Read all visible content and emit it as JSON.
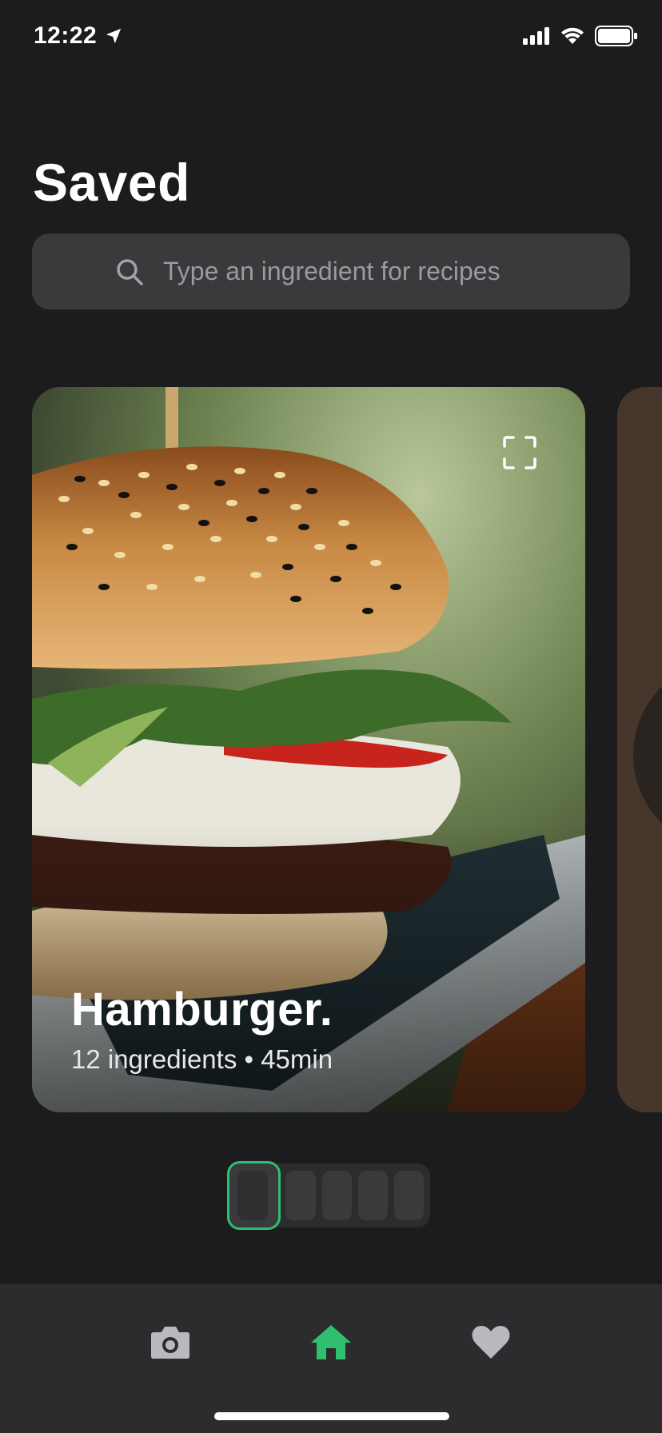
{
  "status_bar": {
    "time": "12:22",
    "icons": [
      "location-arrow-icon",
      "cellular-signal-icon",
      "wifi-icon",
      "battery-icon"
    ]
  },
  "header": {
    "title": "Saved"
  },
  "search": {
    "placeholder": "Type an ingredient for recipes",
    "icon": "search-icon"
  },
  "cards": [
    {
      "title": "Hamburger.",
      "meta": "12 ingredients • 45min",
      "action_icon": "expand-icon"
    }
  ],
  "pager": {
    "count": 5,
    "active_index": 0
  },
  "bottom_nav": {
    "items": [
      {
        "icon": "camera-icon",
        "active": false
      },
      {
        "icon": "home-icon",
        "active": true
      },
      {
        "icon": "heart-icon",
        "active": false
      }
    ]
  },
  "colors": {
    "background": "#1c1c1e",
    "surface": "#2c2c2e",
    "search_field": "#3a3a3c",
    "accent": "#2fbf71",
    "inactive_icon": "#b9b9c0"
  }
}
